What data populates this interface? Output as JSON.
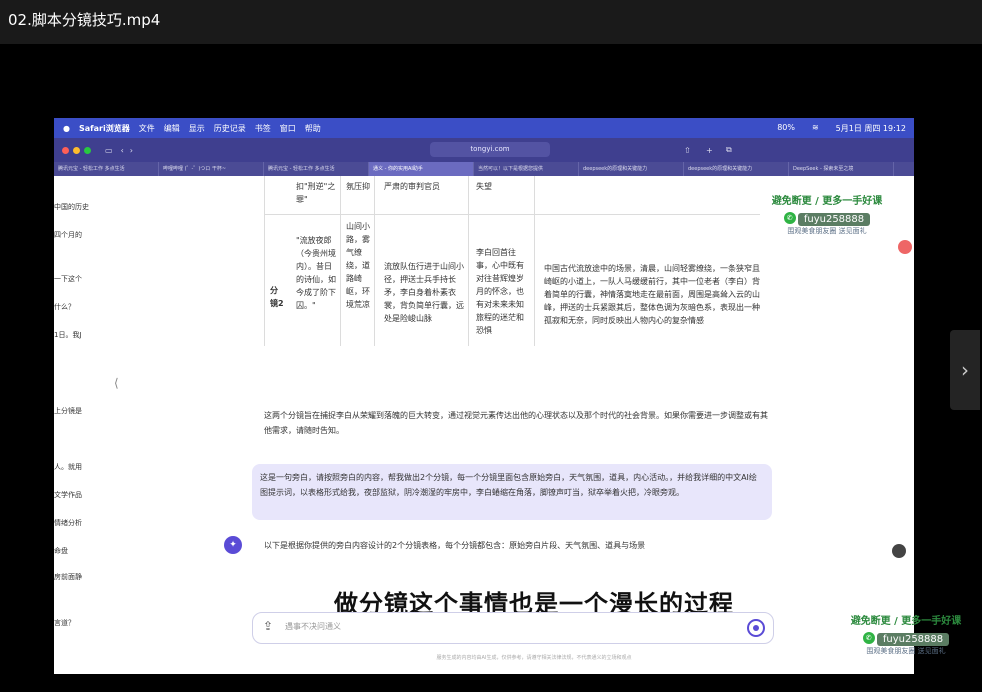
{
  "window": {
    "title": "02.脚本分镜技巧.mp4"
  },
  "menubar": {
    "app": "Safari浏览器",
    "items": [
      "文件",
      "编辑",
      "显示",
      "历史记录",
      "书签",
      "窗口",
      "帮助"
    ],
    "date_time": "5月1日 周四 19:12",
    "battery": "80%"
  },
  "browser": {
    "url": "tongyi.com",
    "tabs": [
      "腾讯元宝 - 轻松工作 多点生活",
      "哔哩哔哩 (゜-゜)つロ 干杯~",
      "腾讯元宝 - 轻松工作 多点生活",
      "通义 - 你的实用AI助手",
      "当然可以！以下是根据您提供",
      "deepseek的原理和关键能力",
      "deepseek的原理和关键能力",
      "DeepSeek - 探索未至之境"
    ]
  },
  "sidebar": {
    "items": [
      "中国的历史",
      "四个月的",
      "一下这个",
      "什么？",
      "1日。我J",
      "上分镜是",
      "人。就用",
      "文学作品",
      "情绪分析",
      "命盘",
      "房前面静",
      "言道？"
    ]
  },
  "table": {
    "top_row": {
      "col1": "扣\"刑逆\"之罪\"",
      "col2": "氛压抑",
      "col3": "严肃的审判官员",
      "col4": "失望"
    },
    "row2": {
      "shot": "分镜2",
      "narration": "\"流放夜郎（今贵州境内）。昔日的诗仙，如今成了阶下囚。\"",
      "scene": "山间小路，雾气缭绕，道路崎岖，环境荒凉",
      "props": "流放队伍行进于山间小径，押送士兵手持长矛，李白身着朴素衣裳，背负简单行囊，远处是险峻山脉",
      "inner": "李白回首往事，心中既有对往昔辉煌岁月的怀念，也有对未来未知旅程的迷茫和恐惧",
      "prompt": "中国古代流放途中的场景，清晨，山间轻雾缭绕，一条狭窄且崎岖的小道上，一队人马缓缓前行，其中一位老者（李白）背着简单的行囊，神情落寞地走在最前面，周围是高耸入云的山峰，押送的士兵紧跟其后，整体色调为灰暗色系，表现出一种孤寂和无奈，同时反映出人物内心的复杂情感"
    }
  },
  "chat": {
    "summary": "这两个分镜旨在捕捉李白从荣耀到落魄的巨大转变，通过视觉元素传达出他的心理状态以及那个时代的社会背景。如果你需要进一步调整或有其他需求，请随时告知。",
    "user_message": "这是一句旁白，请按照旁白的内容，帮我做出2个分镜，每一个分镜里面包含原始旁白，天气氛围，道具，内心活动。，并给我详细的中文AI绘图提示词，以表格形式给我，夜部监狱，阴冷潮湿的牢房中，李白蜷缩在角落，脚镣声叮当，狱卒举着火把，冷眼旁观。",
    "assistant_intro": "以下是根据你提供的旁白内容设计的2个分镜表格，每个分镜都包含：原始旁白片段、天气氛围、道具与场景",
    "input_placeholder": "遇事不决问通义",
    "footer": "服务生成的内容均由AI生成，仅供参考，请遵守相关法律法规，不代表通义的立场和观点"
  },
  "subtitle": "做分镜这个事情也是一个漫长的过程",
  "watermark": {
    "line1": "避免断更 / 更多一手好课",
    "id": "fuyu258888",
    "line3": "围观美食朋友圈 送见面礼"
  },
  "colors": {
    "accent": "#5a4bd6",
    "menubar": "#3b4ec6",
    "bubble": "#e8e6fb"
  }
}
